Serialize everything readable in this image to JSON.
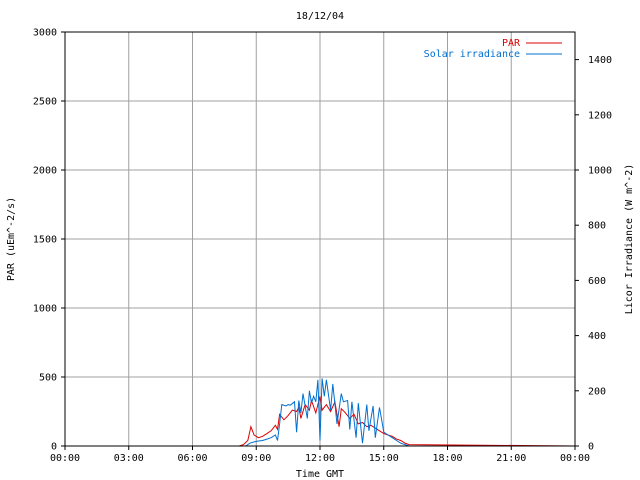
{
  "chart_data": {
    "type": "line",
    "title": "18/12/04",
    "xlabel": "Time GMT",
    "ylabel_left": "PAR (uEm^-2/s)",
    "ylabel_right": "Licor Irradiance (W m^-2)",
    "xlim": [
      0,
      24
    ],
    "ylim_left": [
      0,
      3000
    ],
    "ylim_right": [
      0,
      1500
    ],
    "x_ticks": [
      0,
      3,
      6,
      9,
      12,
      15,
      18,
      21,
      24
    ],
    "x_tick_labels": [
      "00:00",
      "03:00",
      "06:00",
      "09:00",
      "12:00",
      "15:00",
      "18:00",
      "21:00",
      "00:00"
    ],
    "y_left_ticks": [
      0,
      500,
      1000,
      1500,
      2000,
      2500,
      3000
    ],
    "y_left_tick_labels": [
      "0",
      "500",
      "1000",
      "1500",
      "2000",
      "2500",
      "3000"
    ],
    "y_right_ticks": [
      0,
      200,
      400,
      600,
      800,
      1000,
      1200,
      1400
    ],
    "y_right_tick_labels": [
      "0",
      "200",
      "400",
      "600",
      "800",
      "1000",
      "1200",
      "1400"
    ],
    "grid": true,
    "legend_position": "top-right",
    "series": [
      {
        "name": "PAR",
        "axis": "left",
        "color": "#dd0000",
        "x": [
          0,
          8.2,
          8.4,
          8.6,
          8.75,
          8.9,
          9.1,
          9.3,
          9.5,
          9.7,
          9.9,
          10.0,
          10.1,
          10.3,
          10.5,
          10.7,
          10.9,
          11.0,
          11.1,
          11.3,
          11.5,
          11.6,
          11.8,
          12.0,
          12.1,
          12.3,
          12.5,
          12.7,
          12.9,
          13.0,
          13.2,
          13.4,
          13.6,
          13.8,
          14.0,
          14.2,
          14.4,
          14.6,
          14.8,
          15.0,
          15.2,
          15.4,
          15.6,
          15.8,
          16.0,
          16.2,
          24
        ],
        "y": [
          0,
          0,
          10,
          40,
          140,
          80,
          60,
          70,
          90,
          110,
          150,
          120,
          230,
          190,
          220,
          260,
          250,
          280,
          200,
          300,
          260,
          330,
          240,
          360,
          260,
          300,
          250,
          320,
          140,
          270,
          240,
          200,
          230,
          160,
          170,
          140,
          150,
          130,
          110,
          90,
          80,
          70,
          50,
          40,
          20,
          10,
          0
        ]
      },
      {
        "name": "Solar irradiance",
        "axis": "right",
        "color": "#0070d0",
        "x": [
          0,
          8.5,
          8.7,
          8.9,
          9.1,
          9.3,
          9.5,
          9.7,
          9.9,
          10.0,
          10.1,
          10.2,
          10.4,
          10.5,
          10.6,
          10.8,
          10.9,
          11.0,
          11.1,
          11.2,
          11.4,
          11.5,
          11.6,
          11.7,
          11.8,
          11.9,
          12.0,
          12.1,
          12.2,
          12.3,
          12.5,
          12.6,
          12.8,
          13.0,
          13.1,
          13.3,
          13.4,
          13.5,
          13.7,
          13.8,
          14.0,
          14.2,
          14.3,
          14.5,
          14.6,
          14.8,
          15.0,
          15.2,
          15.4,
          15.6,
          15.8,
          16.0,
          16.2,
          24
        ],
        "y": [
          0,
          0,
          10,
          15,
          18,
          20,
          25,
          30,
          40,
          20,
          80,
          150,
          145,
          150,
          148,
          160,
          50,
          165,
          120,
          190,
          100,
          200,
          155,
          180,
          160,
          240,
          20,
          245,
          180,
          240,
          130,
          225,
          80,
          190,
          160,
          165,
          60,
          160,
          30,
          155,
          10,
          150,
          55,
          145,
          30,
          140,
          50,
          40,
          30,
          20,
          10,
          5,
          0,
          0
        ]
      }
    ]
  }
}
